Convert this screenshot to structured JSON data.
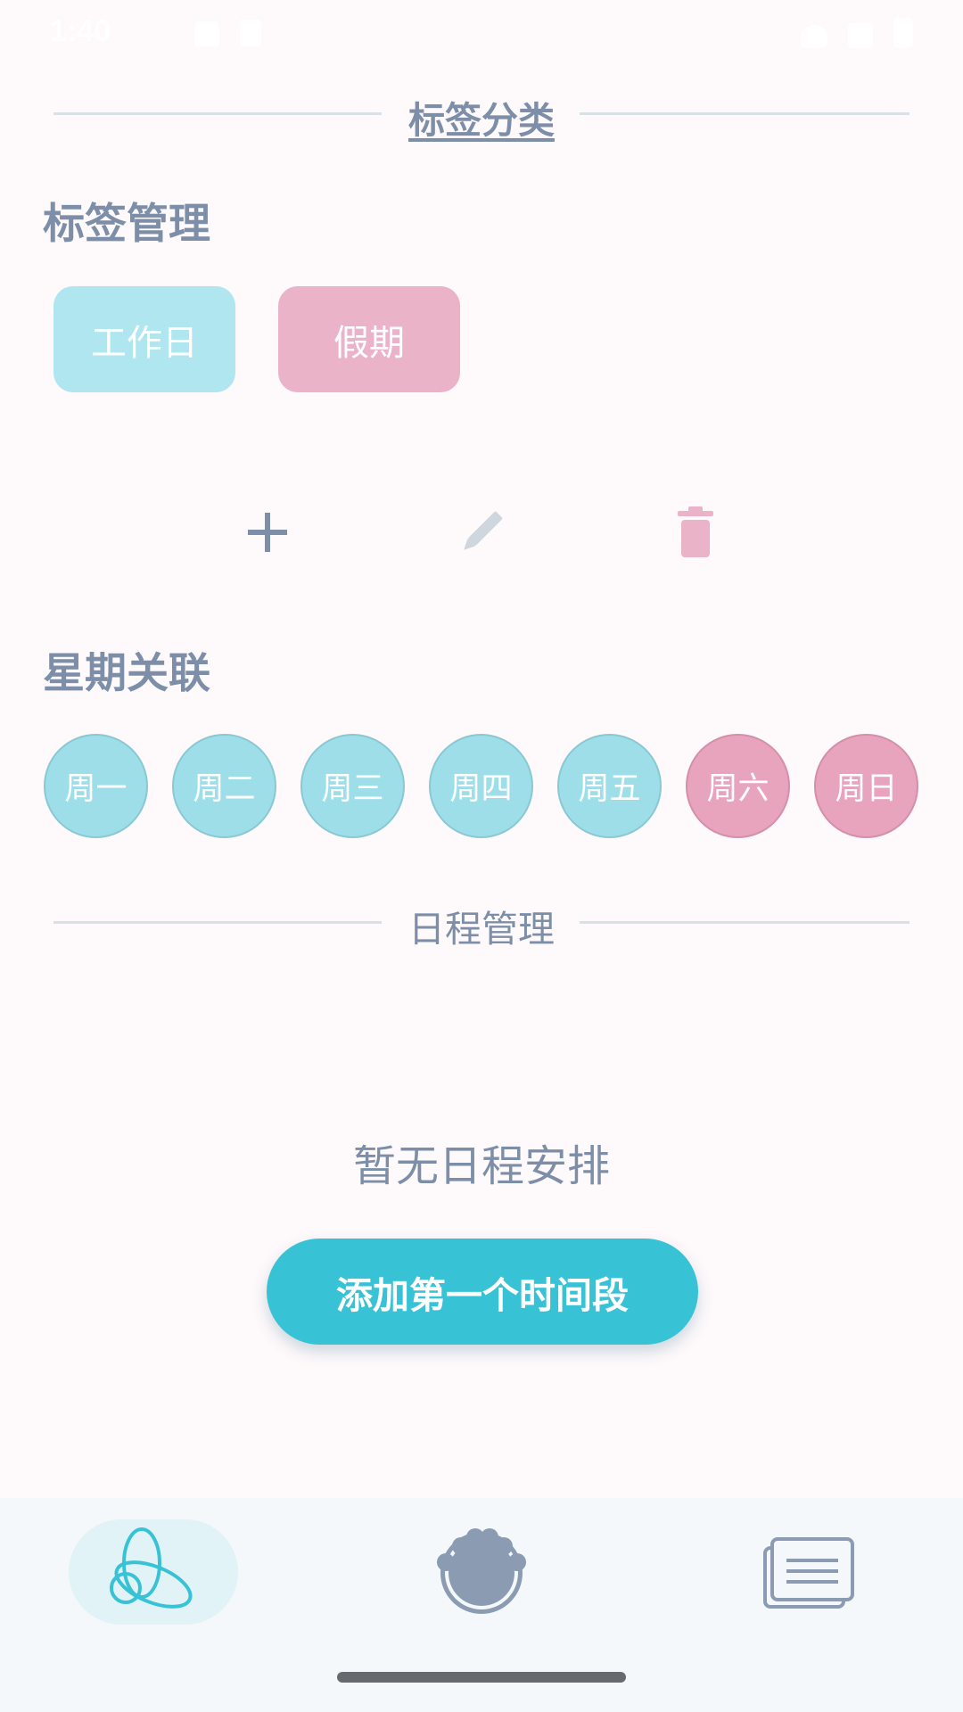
{
  "status_bar": {
    "time": "1:40"
  },
  "tag_section": {
    "title": "标签分类"
  },
  "tag_management": {
    "heading": "标签管理",
    "tags": [
      {
        "label": "工作日",
        "color": "#b0e6ef"
      },
      {
        "label": "假期",
        "color": "#ebb3c8"
      }
    ],
    "actions": {
      "add_icon": "plus-icon",
      "edit_icon": "pencil-icon",
      "delete_icon": "trash-icon"
    }
  },
  "weekday_link": {
    "heading": "星期关联",
    "days": [
      "周一",
      "周二",
      "周三",
      "周四",
      "周五",
      "周六",
      "周日"
    ]
  },
  "schedule_section": {
    "title": "日程管理",
    "empty_text": "暂无日程安排",
    "add_button_label": "添加第一个时间段"
  },
  "bottom_nav": {
    "items": [
      {
        "icon": "loop-ribbon-icon",
        "active": true
      },
      {
        "icon": "paw-icon",
        "active": false
      },
      {
        "icon": "stacked-cards-icon",
        "active": false
      }
    ]
  },
  "colors": {
    "accent": "#38c2d6",
    "weekday": "#9ddee8",
    "weekend": "#e8a3bd",
    "text_muted": "#7d8fa8",
    "background": "#fef9fb"
  }
}
